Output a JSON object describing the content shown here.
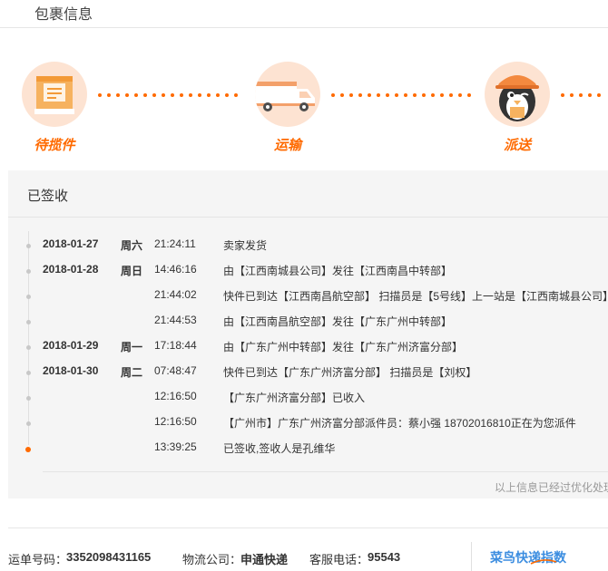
{
  "header": {
    "title": "包裹信息"
  },
  "stages": [
    {
      "label": "待揽件",
      "icon": "package-icon"
    },
    {
      "label": "运输",
      "icon": "truck-icon"
    },
    {
      "label": "派送",
      "icon": "courier-penguin-icon"
    }
  ],
  "status": {
    "title": "已签收"
  },
  "timeline": [
    {
      "date": "2018-01-27",
      "week": "周六",
      "time": "21:24:11",
      "desc": "卖家发货"
    },
    {
      "date": "2018-01-28",
      "week": "周日",
      "time": "14:46:16",
      "desc": "由【江西南城县公司】发往【江西南昌中转部】"
    },
    {
      "date": "",
      "week": "",
      "time": "21:44:02",
      "desc": "快件已到达【江西南昌航空部】 扫描员是【5号线】上一站是【江西南城县公司】"
    },
    {
      "date": "",
      "week": "",
      "time": "21:44:53",
      "desc": "由【江西南昌航空部】发往【广东广州中转部】"
    },
    {
      "date": "2018-01-29",
      "week": "周一",
      "time": "17:18:44",
      "desc": "由【广东广州中转部】发往【广东广州济富分部】"
    },
    {
      "date": "2018-01-30",
      "week": "周二",
      "time": "07:48:47",
      "desc": "快件已到达【广东广州济富分部】 扫描员是【刘权】"
    },
    {
      "date": "",
      "week": "",
      "time": "12:16:50",
      "desc": "【广东广州济富分部】已收入"
    },
    {
      "date": "",
      "week": "",
      "time": "12:16:50",
      "desc": "【广州市】广东广州济富分部派件员：蔡小强 18702016810正在为您派件"
    },
    {
      "date": "",
      "week": "",
      "time": "13:39:25",
      "desc": "已签收,签收人是孔维华"
    }
  ],
  "note": "以上信息已经过优化处理",
  "footer": {
    "tracking_label": "运单号码：",
    "tracking_value": "3352098431165",
    "company_label": "物流公司：",
    "company_value": "申通快递",
    "phone_label": "客服电话：",
    "phone_value": "95543",
    "brand": "菜鸟快递指数"
  },
  "colors": {
    "accent": "#ff6a00",
    "stage_bg": "#fde3d2",
    "brand": "#3b8de0",
    "panel_bg": "#f5f5f5"
  }
}
